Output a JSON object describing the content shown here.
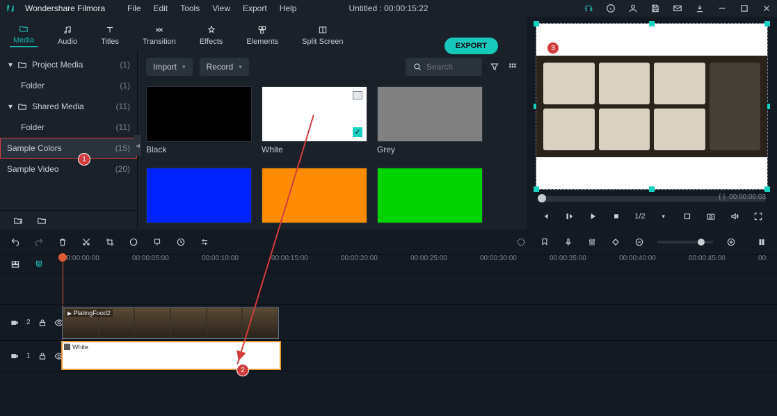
{
  "app": {
    "name": "Wondershare Filmora"
  },
  "menus": [
    "File",
    "Edit",
    "Tools",
    "View",
    "Export",
    "Help"
  ],
  "doc_title": "Untitled : 00:00:15:22",
  "tabs": [
    {
      "label": "Media",
      "icon": "folder"
    },
    {
      "label": "Audio",
      "icon": "music"
    },
    {
      "label": "Titles",
      "icon": "text"
    },
    {
      "label": "Transition",
      "icon": "transition"
    },
    {
      "label": "Effects",
      "icon": "fx"
    },
    {
      "label": "Elements",
      "icon": "elements"
    },
    {
      "label": "Split Screen",
      "icon": "split"
    }
  ],
  "tree": [
    {
      "label": "Project Media",
      "count": "(1)",
      "chev": "▾",
      "folder": true,
      "indent": false
    },
    {
      "label": "Folder",
      "count": "(1)",
      "chev": "",
      "folder": false,
      "indent": true
    },
    {
      "label": "Shared Media",
      "count": "(11)",
      "chev": "▾",
      "folder": true,
      "indent": false
    },
    {
      "label": "Folder",
      "count": "(11)",
      "chev": "",
      "folder": false,
      "indent": true
    },
    {
      "label": "Sample Colors",
      "count": "(15)",
      "chev": "",
      "folder": false,
      "indent": false,
      "selected": true
    },
    {
      "label": "Sample Video",
      "count": "(20)",
      "chev": "",
      "folder": false,
      "indent": false
    }
  ],
  "dropdowns": {
    "import": "Import",
    "record": "Record"
  },
  "search_placeholder": "Search",
  "export_label": "EXPORT",
  "swatches": [
    {
      "name": "Black",
      "color": "#000000",
      "selected": false,
      "thumb": false
    },
    {
      "name": "White",
      "color": "#ffffff",
      "selected": true,
      "thumb": true
    },
    {
      "name": "Grey",
      "color": "#808080",
      "selected": false,
      "thumb": false
    },
    {
      "name": "",
      "color": "#0022ff",
      "selected": false,
      "thumb": false
    },
    {
      "name": "",
      "color": "#ff8c00",
      "selected": false,
      "thumb": false
    },
    {
      "name": "",
      "color": "#00d400",
      "selected": false,
      "thumb": false
    }
  ],
  "preview_time_braces": "{      }",
  "preview_time": "00:00:00:03",
  "transport_rate": "1/2",
  "ruler_ticks": [
    "00:00:00:00",
    "00:00:05:00",
    "00:00:10:00",
    "00:00:15:00",
    "00:00:20:00",
    "00:00:25:00",
    "00:00:30:00",
    "00:00:35:00",
    "00:00:40:00",
    "00:00:45:00",
    "00:"
  ],
  "clip_video_name": "PlatingFood2",
  "clip_white_name": "White",
  "badges": {
    "b1": "1",
    "b2": "2",
    "b3": "3"
  }
}
